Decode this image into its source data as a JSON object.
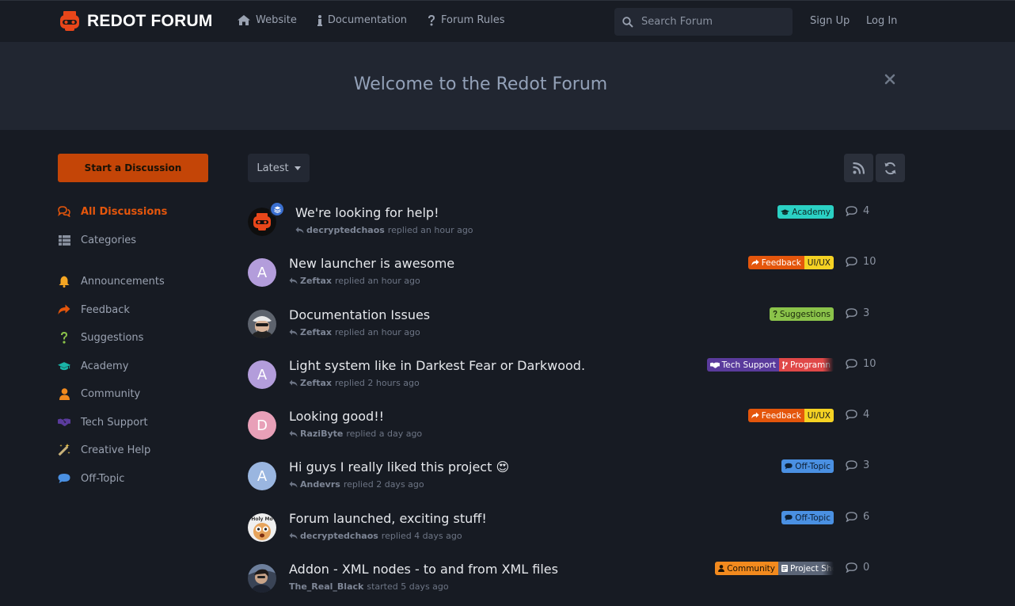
{
  "header": {
    "logo_text": "REDOT FORUM",
    "nav": [
      {
        "label": "Website",
        "icon": "home-icon"
      },
      {
        "label": "Documentation",
        "icon": "info-icon"
      },
      {
        "label": "Forum Rules",
        "icon": "question-icon"
      }
    ],
    "search_placeholder": "Search Forum",
    "sign_up": "Sign Up",
    "log_in": "Log In"
  },
  "hero": {
    "title": "Welcome to the Redot Forum"
  },
  "sidebar": {
    "start_button": "Start a Discussion",
    "items": [
      {
        "label": "All Discussions",
        "icon": "comments-icon",
        "color": "#e4560c"
      },
      {
        "label": "Categories",
        "icon": "list-icon",
        "color": "#8a92a0"
      },
      {
        "label": "Announcements",
        "icon": "bell-icon",
        "color": "#f5a623"
      },
      {
        "label": "Feedback",
        "icon": "share-icon",
        "color": "#e4560c"
      },
      {
        "label": "Suggestions",
        "icon": "question-icon",
        "color": "#8bc34a"
      },
      {
        "label": "Academy",
        "icon": "graduation-cap-icon",
        "color": "#1ab5a8"
      },
      {
        "label": "Community",
        "icon": "user-icon",
        "color": "#f28a1e"
      },
      {
        "label": "Tech Support",
        "icon": "handshake-icon",
        "color": "#5a3b9c"
      },
      {
        "label": "Creative Help",
        "icon": "magic-wand-icon",
        "color": "#f2c94c"
      },
      {
        "label": "Off-Topic",
        "icon": "comment-icon",
        "color": "#4a90e2"
      }
    ]
  },
  "toolbar": {
    "sort_label": "Latest"
  },
  "discussions": [
    {
      "title": "We're looking for help!",
      "user": "decryptedchaos",
      "action": "replied an hour ago",
      "count": "4",
      "tags": [
        {
          "label": "Academy",
          "bg": "#2bd1c4",
          "fg": "#0c2a28"
        }
      ]
    },
    {
      "title": "New launcher is awesome",
      "user": "Zeftax",
      "action": "replied an hour ago",
      "count": "10",
      "tags": [
        {
          "label": "Feedback",
          "bg": "#e4560c",
          "fg": "#ffffff"
        },
        {
          "label": "UI/UX",
          "bg": "#f5d223",
          "fg": "#1a1a1a"
        }
      ]
    },
    {
      "title": "Documentation Issues",
      "user": "Zeftax",
      "action": "replied an hour ago",
      "count": "3",
      "tags": [
        {
          "label": "Suggestions",
          "bg": "#8bc34a",
          "fg": "#1b2a0c"
        }
      ]
    },
    {
      "title": "Light system like in Darkest Fear or Darkwood.",
      "user": "Zeftax",
      "action": "replied 2 hours ago",
      "count": "10",
      "tags": [
        {
          "label": "Tech Support",
          "bg": "#5a3b9c",
          "fg": "#ffffff"
        },
        {
          "label": "Programn",
          "bg": "#e04848",
          "fg": "#ffffff"
        }
      ]
    },
    {
      "title": "Looking good!!",
      "user": "RaziByte",
      "action": "replied a day ago",
      "count": "4",
      "tags": [
        {
          "label": "Feedback",
          "bg": "#e4560c",
          "fg": "#ffffff"
        },
        {
          "label": "UI/UX",
          "bg": "#f5d223",
          "fg": "#1a1a1a"
        }
      ]
    },
    {
      "title": "Hi guys I really liked this project 😍",
      "user": "Andevrs",
      "action": "replied 2 days ago",
      "count": "3",
      "tags": [
        {
          "label": "Off-Topic",
          "bg": "#4a90e2",
          "fg": "#0d1f33"
        }
      ]
    },
    {
      "title": "Forum launched, exciting stuff!",
      "user": "decryptedchaos",
      "action": "replied 4 days ago",
      "count": "6",
      "tags": [
        {
          "label": "Off-Topic",
          "bg": "#4a90e2",
          "fg": "#0d1f33"
        }
      ]
    },
    {
      "title": "Addon - XML nodes - to and from XML files",
      "user": "The_Real_Black",
      "action": "started 5 days ago",
      "count": "0",
      "tags": [
        {
          "label": "Community",
          "bg": "#f28a1e",
          "fg": "#1a1206"
        },
        {
          "label": "Project Sho",
          "bg": "#5b6577",
          "fg": "#ffffff"
        }
      ]
    }
  ],
  "avatars": [
    {
      "type": "logo"
    },
    {
      "type": "letter",
      "letter": "A",
      "bg": "#b39ddb"
    },
    {
      "type": "photo1"
    },
    {
      "type": "letter",
      "letter": "A",
      "bg": "#b39ddb"
    },
    {
      "type": "letter",
      "letter": "D",
      "bg": "#e8a0b8"
    },
    {
      "type": "letter",
      "letter": "A",
      "bg": "#9ab6e0"
    },
    {
      "type": "photo2"
    },
    {
      "type": "photo3"
    }
  ]
}
